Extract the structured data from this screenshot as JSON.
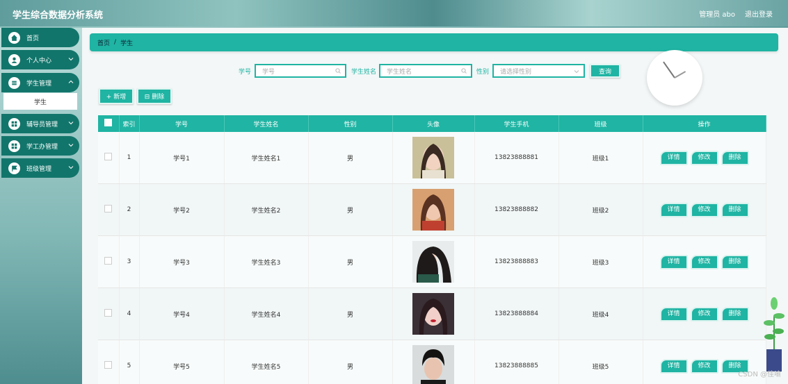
{
  "app": {
    "title": "学生综合数据分析系统"
  },
  "topbar": {
    "user": "管理员 abo",
    "logout": "退出登录"
  },
  "sidebar": {
    "items": [
      {
        "label": "首页"
      },
      {
        "label": "个人中心"
      },
      {
        "label": "学生管理"
      },
      {
        "label": "辅导员管理"
      },
      {
        "label": "学工办管理"
      },
      {
        "label": "班级管理"
      }
    ],
    "subitem": "学生"
  },
  "breadcrumb": {
    "home": "首页",
    "sep": "/",
    "current": "学生"
  },
  "search": {
    "id_label": "学号",
    "id_placeholder": "学号",
    "name_label": "学生姓名",
    "name_placeholder": "学生姓名",
    "gender_label": "性别",
    "gender_placeholder": "请选择性别",
    "query": "查询"
  },
  "actions": {
    "add": "+ 新增",
    "delete": "⊟ 删除"
  },
  "table": {
    "headers": [
      "",
      "索引",
      "学号",
      "学生姓名",
      "性别",
      "头像",
      "学生手机",
      "班级",
      "操作"
    ],
    "rows": [
      {
        "index": "1",
        "id": "学号1",
        "name": "学生姓名1",
        "gender": "男",
        "phone": "13823888881",
        "class": "班级1"
      },
      {
        "index": "2",
        "id": "学号2",
        "name": "学生姓名2",
        "gender": "男",
        "phone": "13823888882",
        "class": "班级2"
      },
      {
        "index": "3",
        "id": "学号3",
        "name": "学生姓名3",
        "gender": "男",
        "phone": "13823888883",
        "class": "班级3"
      },
      {
        "index": "4",
        "id": "学号4",
        "name": "学生姓名4",
        "gender": "男",
        "phone": "13823888884",
        "class": "班级4"
      },
      {
        "index": "5",
        "id": "学号5",
        "name": "学生姓名5",
        "gender": "男",
        "phone": "13823888885",
        "class": "班级5"
      }
    ],
    "ops": {
      "detail": "详情",
      "edit": "修改",
      "del": "删除"
    }
  },
  "watermark": "CSDN @佳喻",
  "colors": {
    "accent": "#1fb4a3",
    "menu": "#12756b"
  }
}
